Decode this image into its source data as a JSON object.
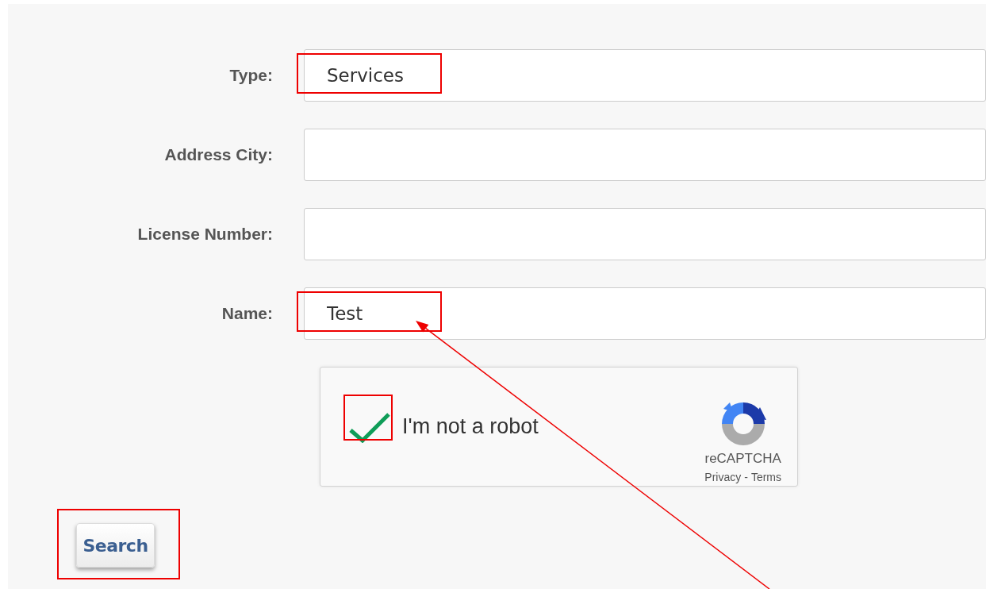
{
  "fields": [
    {
      "label": "Type:",
      "value": "Services",
      "highlighted": true
    },
    {
      "label": "Address City:",
      "highlighted": false
    },
    {
      "label": "License Number:",
      "highlighted": false
    },
    {
      "label": "Name:",
      "value": "Test",
      "highlighted": true,
      "arrow": true
    }
  ],
  "captcha": {
    "label": "I'm not a robot",
    "checked": true,
    "highlighted": true,
    "brand": "reCAPTCHA",
    "privacy": "Privacy",
    "separator": "-",
    "terms": "Terms"
  },
  "search_button": {
    "label": "Search",
    "highlighted": true
  }
}
